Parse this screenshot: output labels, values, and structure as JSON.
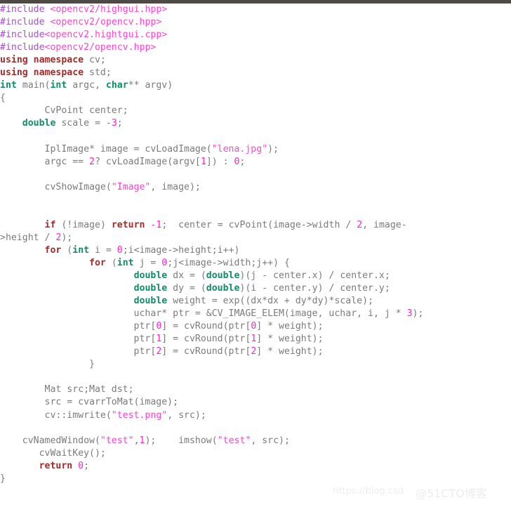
{
  "window": {
    "top_bar_color": "#4d4a46",
    "background_color": "#ffffff"
  },
  "theme": {
    "preprocessor_color": "#a54fd4",
    "header_string_color": "#ff44cc",
    "keyword_color": "#a52a2a",
    "type_color": "#118c69",
    "number_color": "#ff22cc",
    "plain_color": "#7b7b7b"
  },
  "watermark": {
    "url_text": "https://blog.csd",
    "brand_text": "@51CTO博客"
  },
  "code": {
    "language": "C++",
    "lines": [
      "#include <opencv2/highgui.hpp>",
      "#include <opencv2/opencv.hpp>",
      "#include<opencv2.hightgui.cpp>",
      "#include<opencv2/opencv.hpp>",
      "using namespace cv;",
      "using namespace std;",
      "int main(int argc, char** argv)",
      "{",
      "        CvPoint center;",
      "    double scale = -3;",
      "",
      "        IplImage* image = cvLoadImage(\"lena.jpg\");",
      "        argc == 2? cvLoadImage(argv[1]) : 0;",
      "",
      "        cvShowImage(\"Image\", image);",
      "",
      "",
      "        if (!image) return -1;  center = cvPoint(image->width / 2, image-",
      ">height / 2);",
      "        for (int i = 0;i<image->height;i++)",
      "                for (int j = 0;j<image->width;j++) {",
      "                        double dx = (double)(j - center.x) / center.x;",
      "                        double dy = (double)(i - center.y) / center.y;",
      "                        double weight = exp((dx*dx + dy*dy)*scale);",
      "                        uchar* ptr = &CV_IMAGE_ELEM(image, uchar, i, j * 3);",
      "                        ptr[0] = cvRound(ptr[0] * weight);",
      "                        ptr[1] = cvRound(ptr[1] * weight);",
      "                        ptr[2] = cvRound(ptr[2] * weight);",
      "                }",
      "",
      "        Mat src;Mat dst;",
      "        src = cvarrToMat(image);",
      "        cv::imwrite(\"test.png\", src);",
      "",
      "    cvNamedWindow(\"test\",1);    imshow(\"test\", src);",
      "       cvWaitKey();",
      "       return 0;",
      "}"
    ],
    "tokens": [
      [
        [
          "pp",
          "#include"
        ],
        [
          "pl",
          " "
        ],
        [
          "hdr",
          "<opencv2/highgui.hpp>"
        ]
      ],
      [
        [
          "pp",
          "#include"
        ],
        [
          "pl",
          " "
        ],
        [
          "hdr",
          "<opencv2/opencv.hpp>"
        ]
      ],
      [
        [
          "pp",
          "#include"
        ],
        [
          "hdr",
          "<opencv2.hightgui.cpp>"
        ]
      ],
      [
        [
          "pp",
          "#include"
        ],
        [
          "hdr",
          "<opencv2/opencv.hpp>"
        ]
      ],
      [
        [
          "kw",
          "using namespace"
        ],
        [
          "pl",
          " cv;"
        ]
      ],
      [
        [
          "kw",
          "using namespace"
        ],
        [
          "pl",
          " std;"
        ]
      ],
      [
        [
          "ty",
          "int"
        ],
        [
          "pl",
          " main("
        ],
        [
          "ty",
          "int"
        ],
        [
          "pl",
          " argc, "
        ],
        [
          "ty",
          "char"
        ],
        [
          "pl",
          "** argv)"
        ]
      ],
      [
        [
          "pl",
          "{"
        ]
      ],
      [
        [
          "pl",
          "        CvPoint center;"
        ]
      ],
      [
        [
          "pl",
          "    "
        ],
        [
          "ty",
          "double"
        ],
        [
          "pl",
          " scale = "
        ],
        [
          "num",
          "-3"
        ],
        [
          "pl",
          ";"
        ]
      ],
      [
        [
          "pl",
          ""
        ]
      ],
      [
        [
          "pl",
          "        IplImage* image = cvLoadImage("
        ],
        [
          "str",
          "\"lena.jpg\""
        ],
        [
          "pl",
          ");"
        ]
      ],
      [
        [
          "pl",
          "        argc == "
        ],
        [
          "num",
          "2"
        ],
        [
          "pl",
          "? cvLoadImage(argv["
        ],
        [
          "num",
          "1"
        ],
        [
          "pl",
          "]) : "
        ],
        [
          "num",
          "0"
        ],
        [
          "pl",
          ";"
        ]
      ],
      [
        [
          "pl",
          ""
        ]
      ],
      [
        [
          "pl",
          "        cvShowImage("
        ],
        [
          "str",
          "\"Image\""
        ],
        [
          "pl",
          ", image);"
        ]
      ],
      [
        [
          "pl",
          ""
        ]
      ],
      [
        [
          "pl",
          ""
        ]
      ],
      [
        [
          "pl",
          "        "
        ],
        [
          "kw",
          "if"
        ],
        [
          "pl",
          " (!image) "
        ],
        [
          "kw",
          "return"
        ],
        [
          "pl",
          " "
        ],
        [
          "num",
          "-1"
        ],
        [
          "pl",
          ";  center = cvPoint(image->width / "
        ],
        [
          "num",
          "2"
        ],
        [
          "pl",
          ", image-"
        ]
      ],
      [
        [
          "pl",
          ">height / "
        ],
        [
          "num",
          "2"
        ],
        [
          "pl",
          ");"
        ]
      ],
      [
        [
          "pl",
          "        "
        ],
        [
          "kw",
          "for"
        ],
        [
          "pl",
          " ("
        ],
        [
          "ty",
          "int"
        ],
        [
          "pl",
          " i = "
        ],
        [
          "num",
          "0"
        ],
        [
          "pl",
          ";i<image->height;i++)"
        ]
      ],
      [
        [
          "pl",
          "                "
        ],
        [
          "kw",
          "for"
        ],
        [
          "pl",
          " ("
        ],
        [
          "ty",
          "int"
        ],
        [
          "pl",
          " j = "
        ],
        [
          "num",
          "0"
        ],
        [
          "pl",
          ";j<image->width;j++) {"
        ]
      ],
      [
        [
          "pl",
          "                        "
        ],
        [
          "ty",
          "double"
        ],
        [
          "pl",
          " dx = ("
        ],
        [
          "ty",
          "double"
        ],
        [
          "pl",
          ")(j - center.x) / center.x;"
        ]
      ],
      [
        [
          "pl",
          "                        "
        ],
        [
          "ty",
          "double"
        ],
        [
          "pl",
          " dy = ("
        ],
        [
          "ty",
          "double"
        ],
        [
          "pl",
          ")(i - center.y) / center.y;"
        ]
      ],
      [
        [
          "pl",
          "                        "
        ],
        [
          "ty",
          "double"
        ],
        [
          "pl",
          " weight = exp((dx*dx + dy*dy)*scale);"
        ]
      ],
      [
        [
          "pl",
          "                        uchar* ptr = &CV_IMAGE_ELEM(image, uchar, i, j * "
        ],
        [
          "num",
          "3"
        ],
        [
          "pl",
          ");"
        ]
      ],
      [
        [
          "pl",
          "                        ptr["
        ],
        [
          "num",
          "0"
        ],
        [
          "pl",
          "] = cvRound(ptr["
        ],
        [
          "num",
          "0"
        ],
        [
          "pl",
          "] * weight);"
        ]
      ],
      [
        [
          "pl",
          "                        ptr["
        ],
        [
          "num",
          "1"
        ],
        [
          "pl",
          "] = cvRound(ptr["
        ],
        [
          "num",
          "1"
        ],
        [
          "pl",
          "] * weight);"
        ]
      ],
      [
        [
          "pl",
          "                        ptr["
        ],
        [
          "num",
          "2"
        ],
        [
          "pl",
          "] = cvRound(ptr["
        ],
        [
          "num",
          "2"
        ],
        [
          "pl",
          "] * weight);"
        ]
      ],
      [
        [
          "pl",
          "                }"
        ]
      ],
      [
        [
          "pl",
          ""
        ]
      ],
      [
        [
          "pl",
          "        Mat src;Mat dst;"
        ]
      ],
      [
        [
          "pl",
          "        src = cvarrToMat(image);"
        ]
      ],
      [
        [
          "pl",
          "        cv::imwrite("
        ],
        [
          "str",
          "\"test.png\""
        ],
        [
          "pl",
          ", src);"
        ]
      ],
      [
        [
          "pl",
          ""
        ]
      ],
      [
        [
          "pl",
          "    cvNamedWindow("
        ],
        [
          "str",
          "\"test\""
        ],
        [
          "pl",
          ","
        ],
        [
          "num",
          "1"
        ],
        [
          "pl",
          ");    imshow("
        ],
        [
          "str",
          "\"test\""
        ],
        [
          "pl",
          ", src);"
        ]
      ],
      [
        [
          "pl",
          "       cvWaitKey();"
        ]
      ],
      [
        [
          "pl",
          "       "
        ],
        [
          "kw",
          "return"
        ],
        [
          "pl",
          " "
        ],
        [
          "num",
          "0"
        ],
        [
          "pl",
          ";"
        ]
      ],
      [
        [
          "pl",
          "}"
        ]
      ]
    ]
  }
}
